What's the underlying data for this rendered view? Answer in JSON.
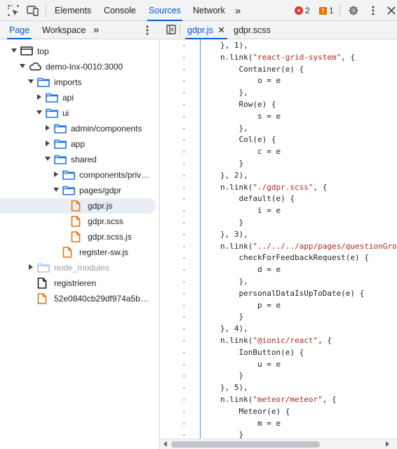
{
  "toolbar": {
    "tabs": [
      {
        "label": "Elements",
        "active": false
      },
      {
        "label": "Console",
        "active": false
      },
      {
        "label": "Sources",
        "active": true
      },
      {
        "label": "Network",
        "active": false
      }
    ],
    "more": "»",
    "errors": "2",
    "warnings": "1",
    "icons": [
      "inspect-element-icon",
      "device-toolbar-icon",
      "settings-icon",
      "more-options-icon",
      "close-icon"
    ]
  },
  "navigator": {
    "tabs": [
      {
        "label": "Page",
        "active": true
      },
      {
        "label": "Workspace",
        "active": false
      }
    ],
    "more": "»",
    "tree": [
      {
        "label": "top",
        "type": "frame",
        "expanded": true
      },
      {
        "label": "demo-lnx-0010:3000",
        "type": "cloud",
        "expanded": true
      },
      {
        "label": "imports",
        "type": "folder",
        "expanded": true
      },
      {
        "label": "api",
        "type": "folder",
        "expanded": false
      },
      {
        "label": "ui",
        "type": "folder",
        "expanded": true
      },
      {
        "label": "admin/components",
        "type": "folder",
        "expanded": false
      },
      {
        "label": "app",
        "type": "folder",
        "expanded": false
      },
      {
        "label": "shared",
        "type": "folder",
        "expanded": true
      },
      {
        "label": "components/priv…",
        "type": "folder",
        "expanded": false
      },
      {
        "label": "pages/gdpr",
        "type": "folder",
        "expanded": true
      },
      {
        "label": "gdpr.js",
        "type": "js-file",
        "selected": true
      },
      {
        "label": "gdpr.scss",
        "type": "js-file"
      },
      {
        "label": "gdpr.scss.js",
        "type": "js-file"
      },
      {
        "label": "register-sw.js",
        "type": "js-file"
      },
      {
        "label": "node_modules",
        "type": "folder-dim",
        "expanded": false
      },
      {
        "label": "registrieren",
        "type": "doc"
      },
      {
        "label": "52e0840cb29df974a5b7…",
        "type": "js-file"
      }
    ]
  },
  "editor": {
    "tabs": [
      {
        "label": "gdpr.js",
        "active": true,
        "closable": true
      },
      {
        "label": "gdpr.scss",
        "active": false
      }
    ],
    "line_marker": "-",
    "lines": [
      [
        {
          "t": "}, 1),"
        }
      ],
      [
        {
          "t": "n.link("
        },
        {
          "t": "\"react-grid-system\"",
          "s": 1
        },
        {
          "t": ", {"
        }
      ],
      [
        {
          "t": "    Container(e) {"
        }
      ],
      [
        {
          "t": "        o = e"
        }
      ],
      [
        {
          "t": "    },"
        }
      ],
      [
        {
          "t": "    Row(e) {"
        }
      ],
      [
        {
          "t": "        s = e"
        }
      ],
      [
        {
          "t": "    },"
        }
      ],
      [
        {
          "t": "    Col(e) {"
        }
      ],
      [
        {
          "t": "        c = e"
        }
      ],
      [
        {
          "t": "    }"
        }
      ],
      [
        {
          "t": "}, 2),"
        }
      ],
      [
        {
          "t": "n.link("
        },
        {
          "t": "\"./gdpr.scss\"",
          "s": 1
        },
        {
          "t": ", {"
        }
      ],
      [
        {
          "t": "    default(e) {"
        }
      ],
      [
        {
          "t": "        i = e"
        }
      ],
      [
        {
          "t": "    }"
        }
      ],
      [
        {
          "t": "}, 3),"
        }
      ],
      [
        {
          "t": "n.link("
        },
        {
          "t": "\"../../../app/pages/questionGro",
          "s": 1
        }
      ],
      [
        {
          "t": "    checkForFeedbackRequest(e) {"
        }
      ],
      [
        {
          "t": "        d = e"
        }
      ],
      [
        {
          "t": "    },"
        }
      ],
      [
        {
          "t": "    personalDataIsUpToDate(e) {"
        }
      ],
      [
        {
          "t": "        p = e"
        }
      ],
      [
        {
          "t": "    }"
        }
      ],
      [
        {
          "t": "}, 4),"
        }
      ],
      [
        {
          "t": "n.link("
        },
        {
          "t": "\"@ionic/react\"",
          "s": 1
        },
        {
          "t": ", {"
        }
      ],
      [
        {
          "t": "    IonButton(e) {"
        }
      ],
      [
        {
          "t": "        u = e"
        }
      ],
      [
        {
          "t": "    }"
        }
      ],
      [
        {
          "t": "}, 5),"
        }
      ],
      [
        {
          "t": "n.link("
        },
        {
          "t": "\"meteor/meteor\"",
          "s": 1
        },
        {
          "t": ", {"
        }
      ],
      [
        {
          "t": "    Meteor(e) {"
        }
      ],
      [
        {
          "t": "        m = e"
        }
      ],
      [
        {
          "t": "    }"
        }
      ]
    ]
  },
  "colors": {
    "accent": "#0b57d0",
    "folder": "#1a73e8",
    "js_file": "#e8710a",
    "string": "#b3261e",
    "error": "#dc362e",
    "warning": "#e37400"
  }
}
